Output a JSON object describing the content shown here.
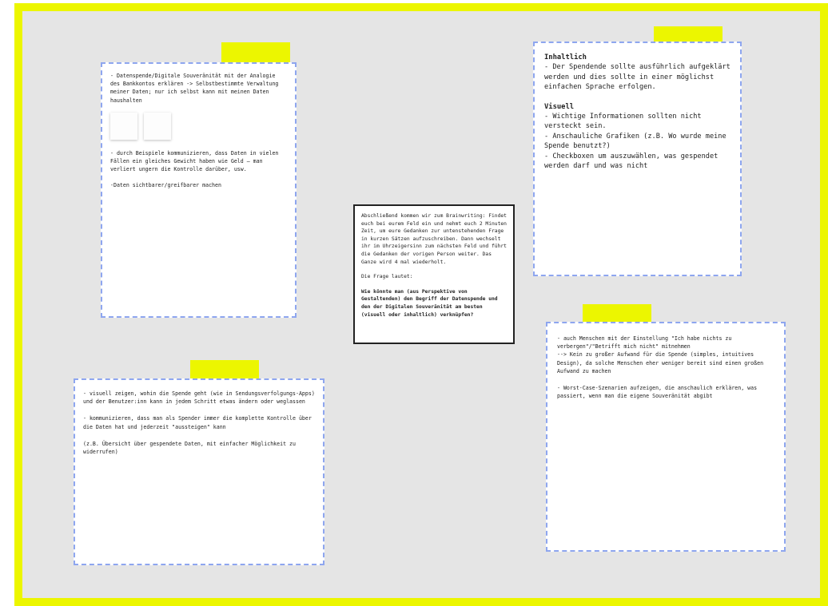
{
  "card_top_left": {
    "text1": "- Datenspende/Digitale Souveränität mit der Analogie des Bankkontos erklären -> Selbstbestimmte Verwaltung meiner Daten; nur ich selbst kann mit meinen Daten haushalten",
    "text2": "- durch Beispiele kommunizieren, dass Daten in vielen Fällen ein gleiches Gewicht haben wie Geld – man verliert ungern die Kontrolle darüber, usw.",
    "text3": "-Daten sichtbarer/greifbarer machen"
  },
  "card_top_right": {
    "heading1": "Inhaltlich",
    "body1": "- Der Spendende sollte ausführlich aufgeklärt werden und dies sollte in einer möglichst einfachen Sprache erfolgen.",
    "heading2": "Visuell",
    "body2": "- Wichtige Informationen sollten nicht versteckt sein.\n- Anschauliche Grafiken (z.B. Wo wurde meine Spende benutzt?)\n- Checkboxen um auszuwählen, was gespendet werden darf und was nicht"
  },
  "center_box": {
    "intro": "Abschließend kommen wir zum Brainwriting: Findet euch bei eurem Feld ein und nehmt euch 2 Minuten Zeit, um eure Gedanken zur untenstehenden Frage in kurzen Sätzen aufzuschreiben. Dann wechselt ihr im Uhrzeigersinn zum nächsten Feld und führt die Gedanken der vorigen Person weiter. Das Ganze wird 4 mal wiederholt.",
    "question_label": "Die Frage lautet:",
    "question": "Wie könnte man (aus Perspektive von Gestaltenden) den Begriff der Datenspende und den der Digitalen Souveränität am besten (visuell oder inhaltlich) verknüpfen?"
  },
  "card_bottom_left": {
    "text1": "- visuell zeigen, wohin die Spende geht (wie in Sendungsverfolgungs-Apps) und der Benutzer:inn kann in jedem Schritt etwas ändern oder weglassen",
    "text2": "- kommunizieren, dass man als Spender immer die komplette Kontrolle über die Daten hat und jederzeit \"aussteigen\" kann",
    "text3": "(z.B. Übersicht über gespendete Daten, mit einfacher Möglichkeit zu widerrufen)"
  },
  "card_bottom_right": {
    "text1": "- auch Menschen mit der Einstellung \"Ich habe nichts zu verbergen\"/\"Betrifft mich nicht\" mitnehmen\n--> Kein zu großer Aufwand für die Spende (simples, intuitives Design), da solche Menschen eher weniger bereit sind einen großen Aufwand zu machen",
    "text2": "- Worst-Case-Szenarien aufzeigen, die anschaulich erklären, was passiert, wenn man die eigene Souveränität abgibt"
  },
  "colors": {
    "frame": "#ecf600",
    "board": "#e5e5e5",
    "card_border": "#8ea6ef",
    "tag": "#ecf600"
  }
}
